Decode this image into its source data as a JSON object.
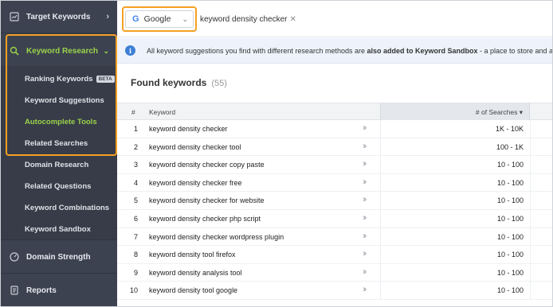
{
  "sidebar": {
    "target_keywords": "Target Keywords",
    "keyword_research": "Keyword Research",
    "sub_items": [
      {
        "label": "Ranking Keywords",
        "badge": "BETA"
      },
      {
        "label": "Keyword Suggestions"
      },
      {
        "label": "Autocomplete Tools"
      },
      {
        "label": "Related Searches"
      },
      {
        "label": "Domain Research"
      },
      {
        "label": "Related Questions"
      },
      {
        "label": "Keyword Combinations"
      },
      {
        "label": "Keyword Sandbox"
      }
    ],
    "domain_strength": "Domain Strength",
    "reports": "Reports",
    "active_color": "#9bd34a",
    "highlight_color": "#f4a023"
  },
  "topbar": {
    "engine": "Google",
    "keyword_tag": "keyword density checker"
  },
  "info": {
    "text_before": "All keyword suggestions you find with different research methods are ",
    "text_bold": "also added to Keyword Sandbox",
    "text_after": " - a place to store and a"
  },
  "found": {
    "title": "Found keywords",
    "count": "(55)"
  },
  "table": {
    "headers": {
      "num": "#",
      "keyword": "Keyword",
      "searches": "# of Searches ▾"
    },
    "rows": [
      {
        "n": "1",
        "keyword": "keyword density checker",
        "searches": "1K - 10K"
      },
      {
        "n": "2",
        "keyword": "keyword density checker tool",
        "searches": "100 - 1K"
      },
      {
        "n": "3",
        "keyword": "keyword density checker copy paste",
        "searches": "10 - 100"
      },
      {
        "n": "4",
        "keyword": "keyword density checker free",
        "searches": "10 - 100"
      },
      {
        "n": "5",
        "keyword": "keyword density checker for website",
        "searches": "10 - 100"
      },
      {
        "n": "6",
        "keyword": "keyword density checker php script",
        "searches": "10 - 100"
      },
      {
        "n": "7",
        "keyword": "keyword density checker wordpress plugin",
        "searches": "10 - 100"
      },
      {
        "n": "8",
        "keyword": "keyword density tool firefox",
        "searches": "10 - 100"
      },
      {
        "n": "9",
        "keyword": "keyword density analysis tool",
        "searches": "10 - 100"
      },
      {
        "n": "10",
        "keyword": "keyword density tool google",
        "searches": "10 - 100"
      }
    ]
  }
}
